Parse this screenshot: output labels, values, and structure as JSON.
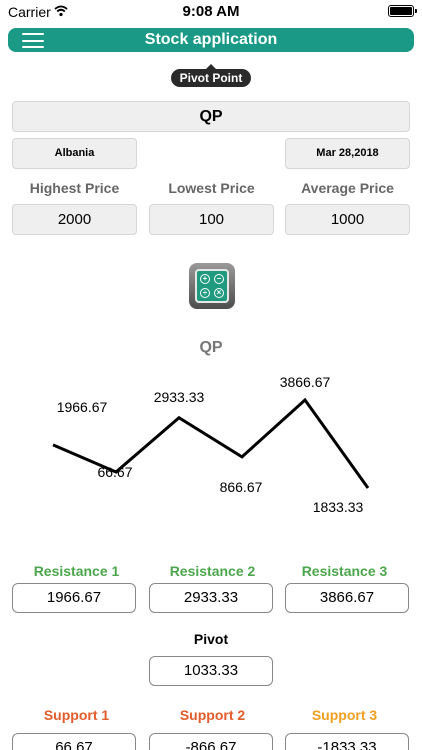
{
  "status_bar": {
    "carrier": "Carrier",
    "time": "9:08 AM"
  },
  "header": {
    "title": "Stock application"
  },
  "mode_label": "Pivot Point",
  "symbol": "QP",
  "country": "Albania",
  "date": "Mar 28,2018",
  "price_labels": {
    "highest": "Highest Price",
    "lowest": "Lowest Price",
    "average": "Average Price"
  },
  "prices": {
    "highest": "2000",
    "lowest": "100",
    "average": "1000"
  },
  "chart_title": "QP",
  "chart_data": {
    "type": "line",
    "title": "QP",
    "x": [
      0,
      1,
      2,
      3,
      4,
      5,
      6
    ],
    "values": [
      1966.67,
      66.67,
      2933.33,
      866.67,
      3866.67,
      1833.33
    ],
    "labels": [
      "1966.67",
      "66.67",
      "2933.33",
      "866.67",
      "3866.67",
      "1833.33"
    ],
    "line_values": [
      1500,
      66.67,
      2933.33,
      866.67,
      3866.67,
      1833.33
    ],
    "color": "#000000"
  },
  "resistance": {
    "labels": [
      "Resistance 1",
      "Resistance 2",
      "Resistance 3"
    ],
    "values": [
      "1966.67",
      "2933.33",
      "3866.67"
    ]
  },
  "pivot": {
    "label": "Pivot",
    "value": "1033.33"
  },
  "support": {
    "labels": [
      "Support 1",
      "Support 2",
      "Support 3"
    ],
    "values": [
      "66.67",
      "-866.67",
      "-1833.33"
    ]
  },
  "colors": {
    "accent": "#1a9a86",
    "resistance": "#4ca64c",
    "support1": "#e25b2a",
    "support2": "#e25b2a",
    "support3": "#f0a020"
  },
  "icons": {
    "menu": "hamburger-icon",
    "wifi": "wifi-icon",
    "battery": "battery-icon",
    "calculator": "calculator-icon"
  }
}
